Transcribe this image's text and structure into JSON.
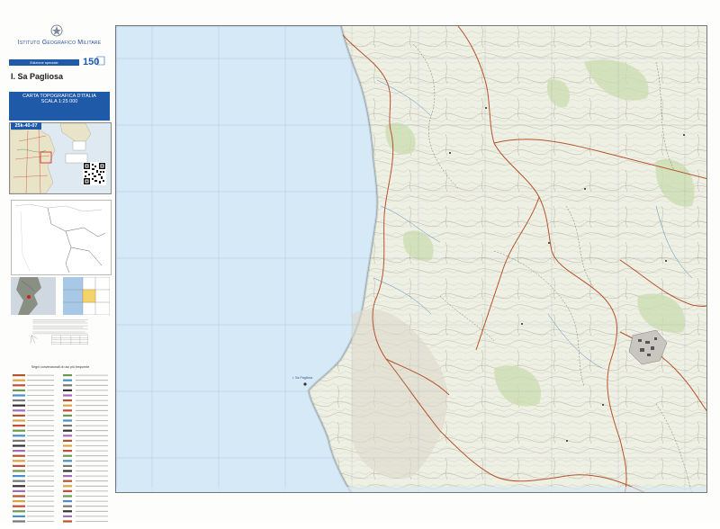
{
  "header": {
    "institute_name": "Istituto Geografico Militare",
    "edition_label": "Edizione speciale",
    "anniversary_logo": "150",
    "sheet_title": "I. Sa Pagliosa",
    "map_series": "CARTA TOPOGRAFICA D'ITALIA",
    "scale_label": "SCALA 1:25 000",
    "sheet_code": "25k-40-07"
  },
  "legend": {
    "signs_title": "Segni convenzionali di uso più frequente"
  },
  "map": {
    "sea_color": "#d5e9f7",
    "land_color": "#eef0e4",
    "relief_color": "#9a9a8a",
    "road_color": "#b5542c",
    "vegetation_color": "#c9dcb0",
    "label_sea_point": "I. Sa Pagliosa"
  },
  "colors": {
    "brand_blue": "#1f5aa8",
    "title_text": "#1c1c1c"
  }
}
